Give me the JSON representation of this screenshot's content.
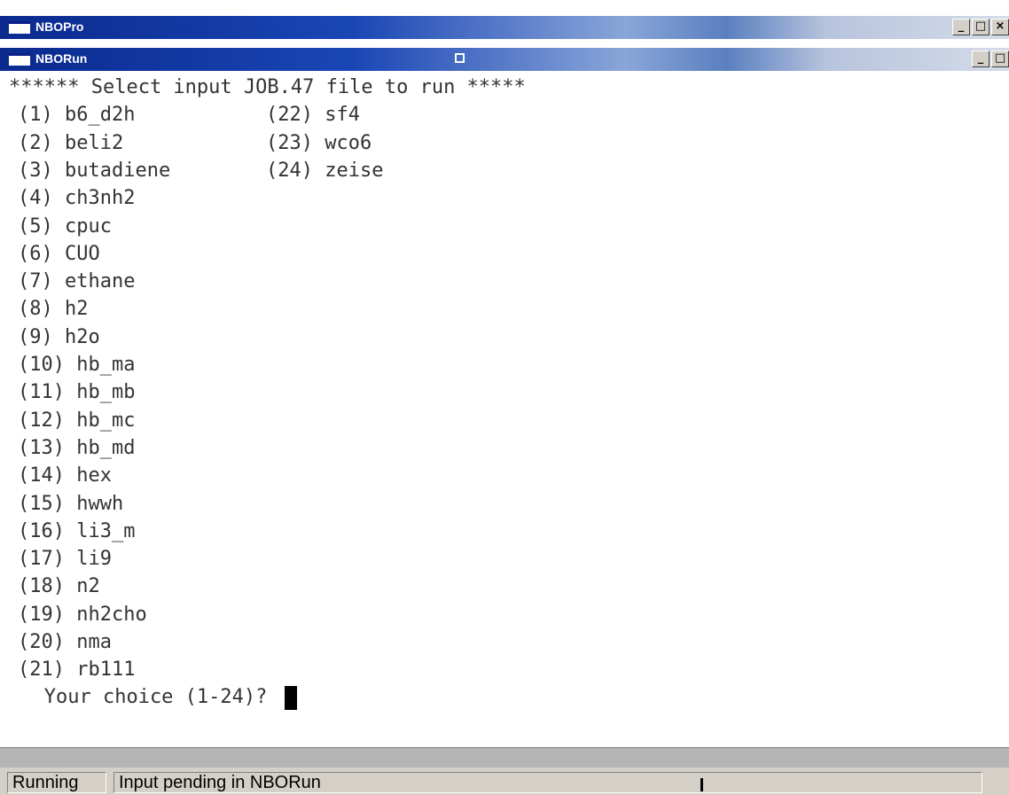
{
  "outer_window": {
    "title": "NBOPro",
    "buttons": [
      "_",
      "□",
      "×"
    ]
  },
  "inner_window": {
    "title": "NBORun",
    "buttons": [
      "_",
      "□"
    ]
  },
  "console": {
    "header": "****** Select input JOB.47 file to run *****",
    "column1": [
      "(1) b6_d2h",
      "(2) beli2",
      "(3) butadiene",
      "(4) ch3nh2",
      "(5) cpuc",
      "(6) CUO",
      "(7) ethane",
      "(8) h2",
      "(9) h2o",
      "(10) hb_ma",
      "(11) hb_mb",
      "(12) hb_mc",
      "(13) hb_md",
      "(14) hex",
      "(15) hwwh",
      "(16) li3_m",
      "(17) li9",
      "(18) n2",
      "(19) nh2cho",
      "(20) nma",
      "(21) rb111"
    ],
    "column2": [
      "(22) sf4",
      "(23) wco6",
      "(24) zeise"
    ],
    "prompt": "   Your choice (1-24)? "
  },
  "statusbar": {
    "state": "Running",
    "message": "Input pending in NBORun"
  }
}
